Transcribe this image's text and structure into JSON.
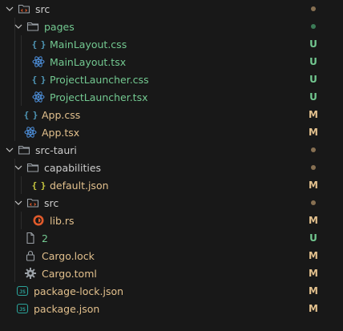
{
  "explorer": {
    "items": [
      {
        "label": "src",
        "kind": "folder-open",
        "icon": "folder-src-icon",
        "color": "#cccccc",
        "status": "dot-mod"
      },
      {
        "label": "pages",
        "kind": "folder-open",
        "icon": "folder-icon",
        "color": "#73c991",
        "status": "dot-untracked"
      },
      {
        "label": "MainLayout.css",
        "kind": "file",
        "icon": "css-braces-icon",
        "color": "#73c991",
        "status": "U"
      },
      {
        "label": "MainLayout.tsx",
        "kind": "file",
        "icon": "react-icon",
        "color": "#73c991",
        "status": "U"
      },
      {
        "label": "ProjectLauncher.css",
        "kind": "file",
        "icon": "css-braces-icon",
        "color": "#73c991",
        "status": "U"
      },
      {
        "label": "ProjectLauncher.tsx",
        "kind": "file",
        "icon": "react-icon",
        "color": "#73c991",
        "status": "U"
      },
      {
        "label": "App.css",
        "kind": "file",
        "icon": "css-braces-icon",
        "color": "#e2c08d",
        "status": "M"
      },
      {
        "label": "App.tsx",
        "kind": "file",
        "icon": "react-icon",
        "color": "#e2c08d",
        "status": "M"
      },
      {
        "label": "src-tauri",
        "kind": "folder-open",
        "icon": "folder-icon",
        "color": "#cccccc",
        "status": "dot-mod"
      },
      {
        "label": "capabilities",
        "kind": "folder-open",
        "icon": "folder-icon",
        "color": "#cccccc",
        "status": "dot-mod"
      },
      {
        "label": "default.json",
        "kind": "file",
        "icon": "json-braces-icon",
        "color": "#e2c08d",
        "status": "M"
      },
      {
        "label": "src",
        "kind": "folder-open",
        "icon": "folder-src-icon",
        "color": "#cccccc",
        "status": "dot-mod"
      },
      {
        "label": "lib.rs",
        "kind": "file",
        "icon": "rust-icon",
        "color": "#e2c08d",
        "status": "M"
      },
      {
        "label": "2",
        "kind": "file",
        "icon": "file-icon",
        "color": "#73c991",
        "status": "U"
      },
      {
        "label": "Cargo.lock",
        "kind": "file",
        "icon": "lock-icon",
        "color": "#e2c08d",
        "status": "M"
      },
      {
        "label": "Cargo.toml",
        "kind": "file",
        "icon": "gear-icon",
        "color": "#e2c08d",
        "status": "M"
      },
      {
        "label": "package-lock.json",
        "kind": "file",
        "icon": "npm-json-icon",
        "color": "#e2c08d",
        "status": "M"
      },
      {
        "label": "package.json",
        "kind": "file",
        "icon": "npm-json-icon",
        "color": "#e2c08d",
        "status": "M"
      }
    ],
    "colors": {
      "background": "#181818",
      "modified": "#e2c08d",
      "untracked": "#73c991",
      "text": "#cccccc",
      "css_icon": "#519aba",
      "react_icon": "#4d8fdb",
      "json_icon": "#cbcb41",
      "rust_icon": "#e05a2b",
      "npm_icon": "#2aa198",
      "folder_icon": "#9aa0a6"
    }
  }
}
